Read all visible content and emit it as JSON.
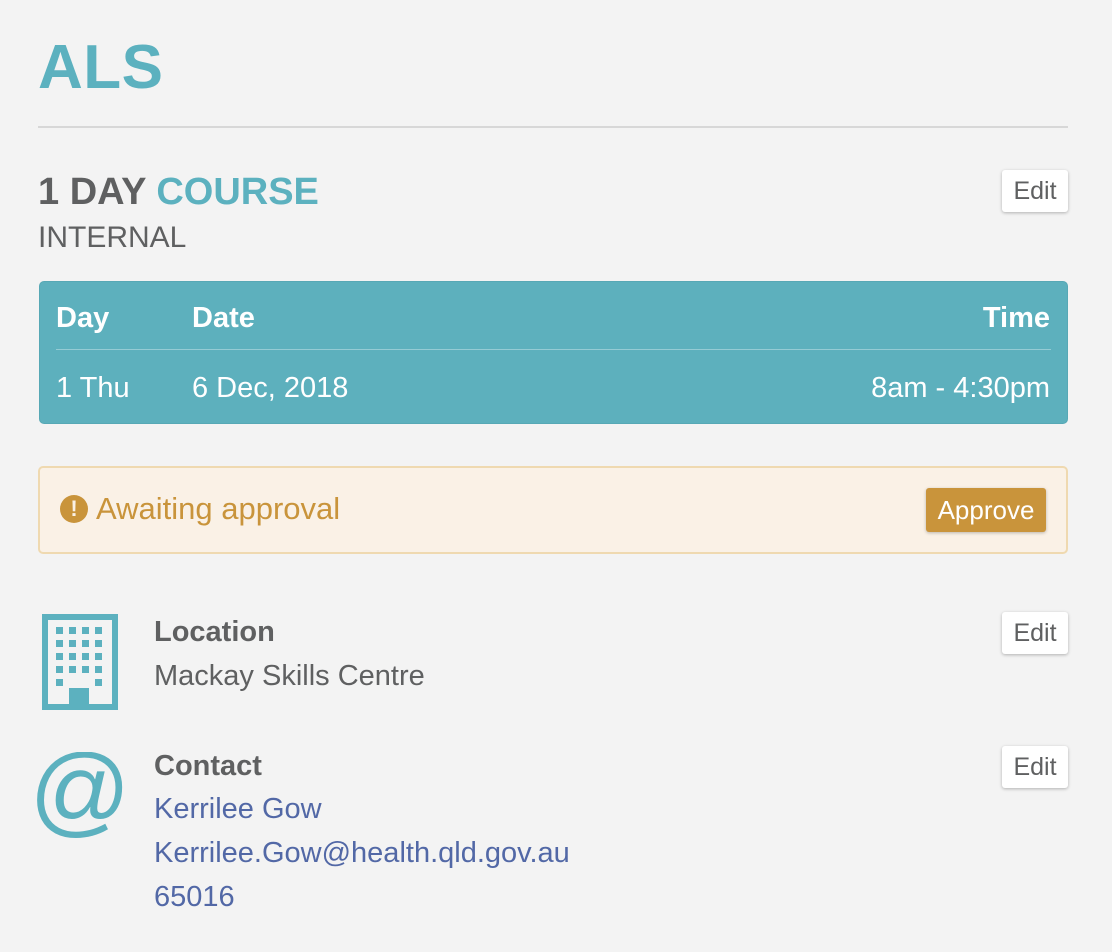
{
  "page": {
    "title": "ALS"
  },
  "course": {
    "duration_label": "1 DAY",
    "course_word": "COURSE",
    "type": "INTERNAL",
    "edit_label": "Edit"
  },
  "schedule": {
    "headers": {
      "day": "Day",
      "date": "Date",
      "time": "Time"
    },
    "rows": [
      {
        "day": "1 Thu",
        "date": "6 Dec, 2018",
        "time": "8am - 4:30pm"
      }
    ]
  },
  "approval": {
    "icon": "exclamation-circle-icon",
    "icon_glyph": "!",
    "message": "Awaiting approval",
    "button_label": "Approve"
  },
  "location": {
    "icon": "building-icon",
    "label": "Location",
    "value": "Mackay Skills Centre",
    "edit_label": "Edit"
  },
  "contact": {
    "icon": "at-sign-icon",
    "icon_glyph": "@",
    "label": "Contact",
    "name": "Kerrilee Gow",
    "email": "Kerrilee.Gow@health.qld.gov.au",
    "phone": "65016",
    "edit_label": "Edit"
  },
  "colors": {
    "accent": "#5cb1bf",
    "text": "#5f6061",
    "warning": "#c9943b",
    "warning_bg": "#faf1e6",
    "link": "#5268a6"
  }
}
